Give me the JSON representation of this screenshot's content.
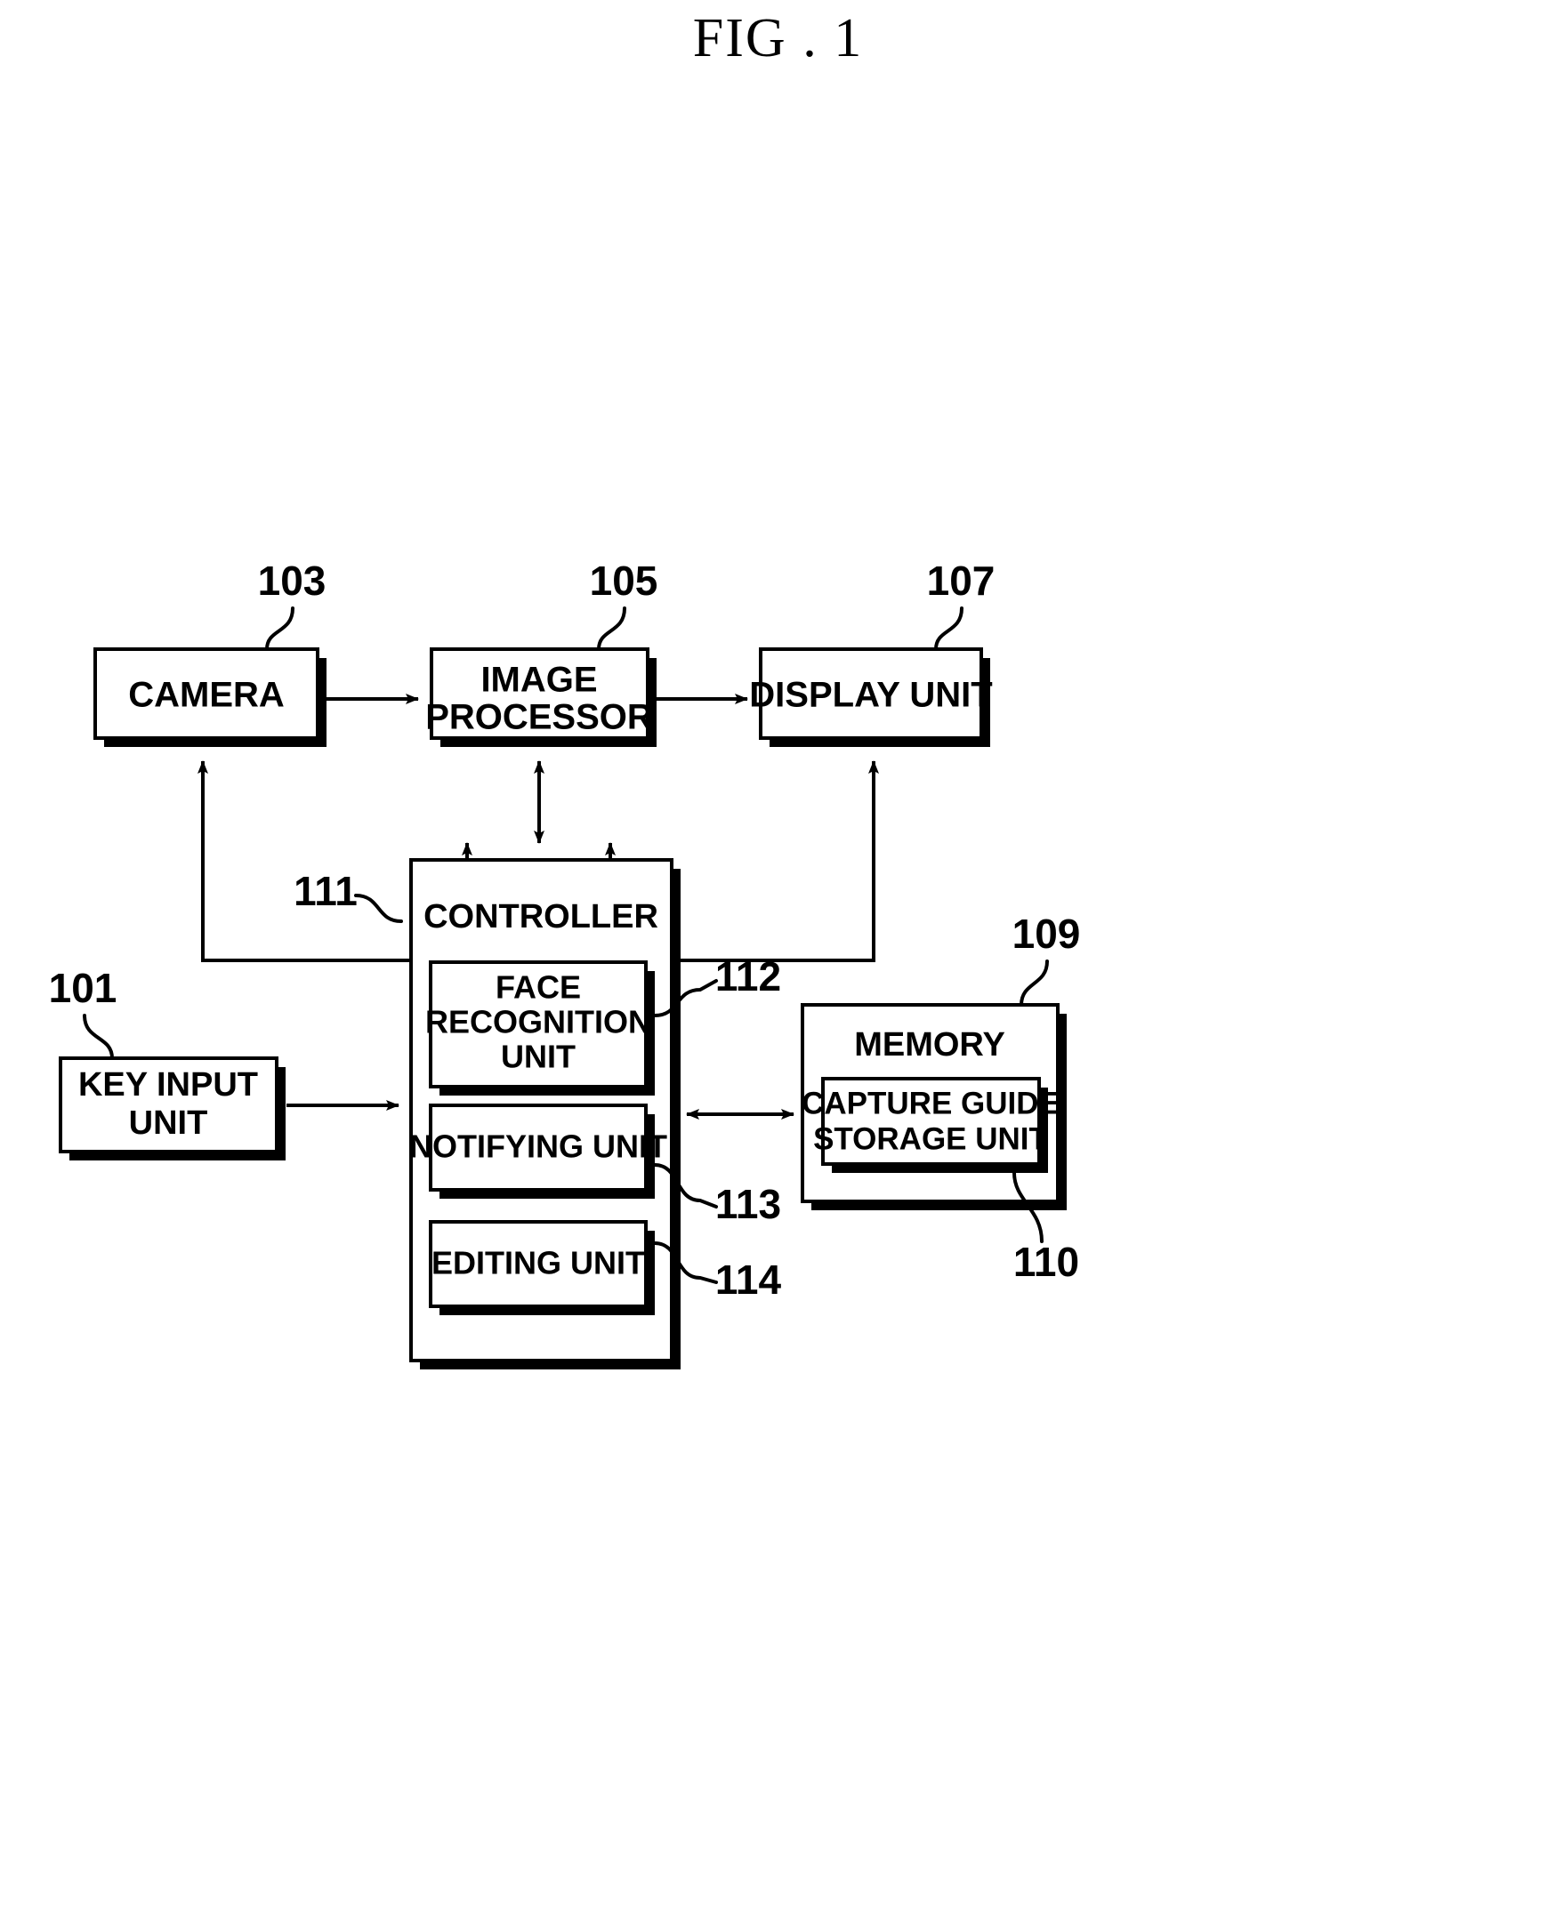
{
  "figure": {
    "title": "FIG . 1",
    "domain_type": "patent-block-diagram"
  },
  "blocks": {
    "key_input_unit": {
      "label_line1": "KEY INPUT",
      "label_line2": "UNIT",
      "ref": "101"
    },
    "camera": {
      "label": "CAMERA",
      "ref": "103"
    },
    "image_processor": {
      "label_line1": "IMAGE",
      "label_line2": "PROCESSOR",
      "ref": "105"
    },
    "display_unit": {
      "label": "DISPLAY UNIT",
      "ref": "107"
    },
    "memory": {
      "label": "MEMORY",
      "ref": "109"
    },
    "capture_guide_storage_unit": {
      "label_line1": "CAPTURE GUIDE",
      "label_line2": "STORAGE UNIT",
      "ref": "110"
    },
    "controller": {
      "label": "CONTROLLER",
      "ref": "111"
    },
    "face_recognition_unit": {
      "label_line1": "FACE",
      "label_line2": "RECOGNITION",
      "label_line3": "UNIT",
      "ref": "112"
    },
    "notifying_unit": {
      "label": "NOTIFYING UNIT",
      "ref": "113"
    },
    "editing_unit": {
      "label": "EDITING UNIT",
      "ref": "114"
    }
  },
  "connections": [
    {
      "name": "camera-to-image-processor",
      "from": "camera",
      "to": "image_processor",
      "style": "single-arrow"
    },
    {
      "name": "image-processor-to-display-unit",
      "from": "image_processor",
      "to": "display_unit",
      "style": "single-arrow"
    },
    {
      "name": "controller-to-camera",
      "from": "controller",
      "to": "camera",
      "style": "single-arrow"
    },
    {
      "name": "controller-image-processor-bidir",
      "from": "controller",
      "to": "image_processor",
      "style": "double-arrow"
    },
    {
      "name": "display-unit-to-controller",
      "from": "display_unit",
      "to": "controller",
      "style": "single-arrow"
    },
    {
      "name": "key-input-unit-to-controller",
      "from": "key_input_unit",
      "to": "controller",
      "style": "single-arrow"
    },
    {
      "name": "controller-memory-bidir",
      "from": "controller",
      "to": "memory",
      "style": "double-arrow"
    }
  ],
  "colors": {
    "ink": "#000000",
    "paper": "#ffffff"
  }
}
